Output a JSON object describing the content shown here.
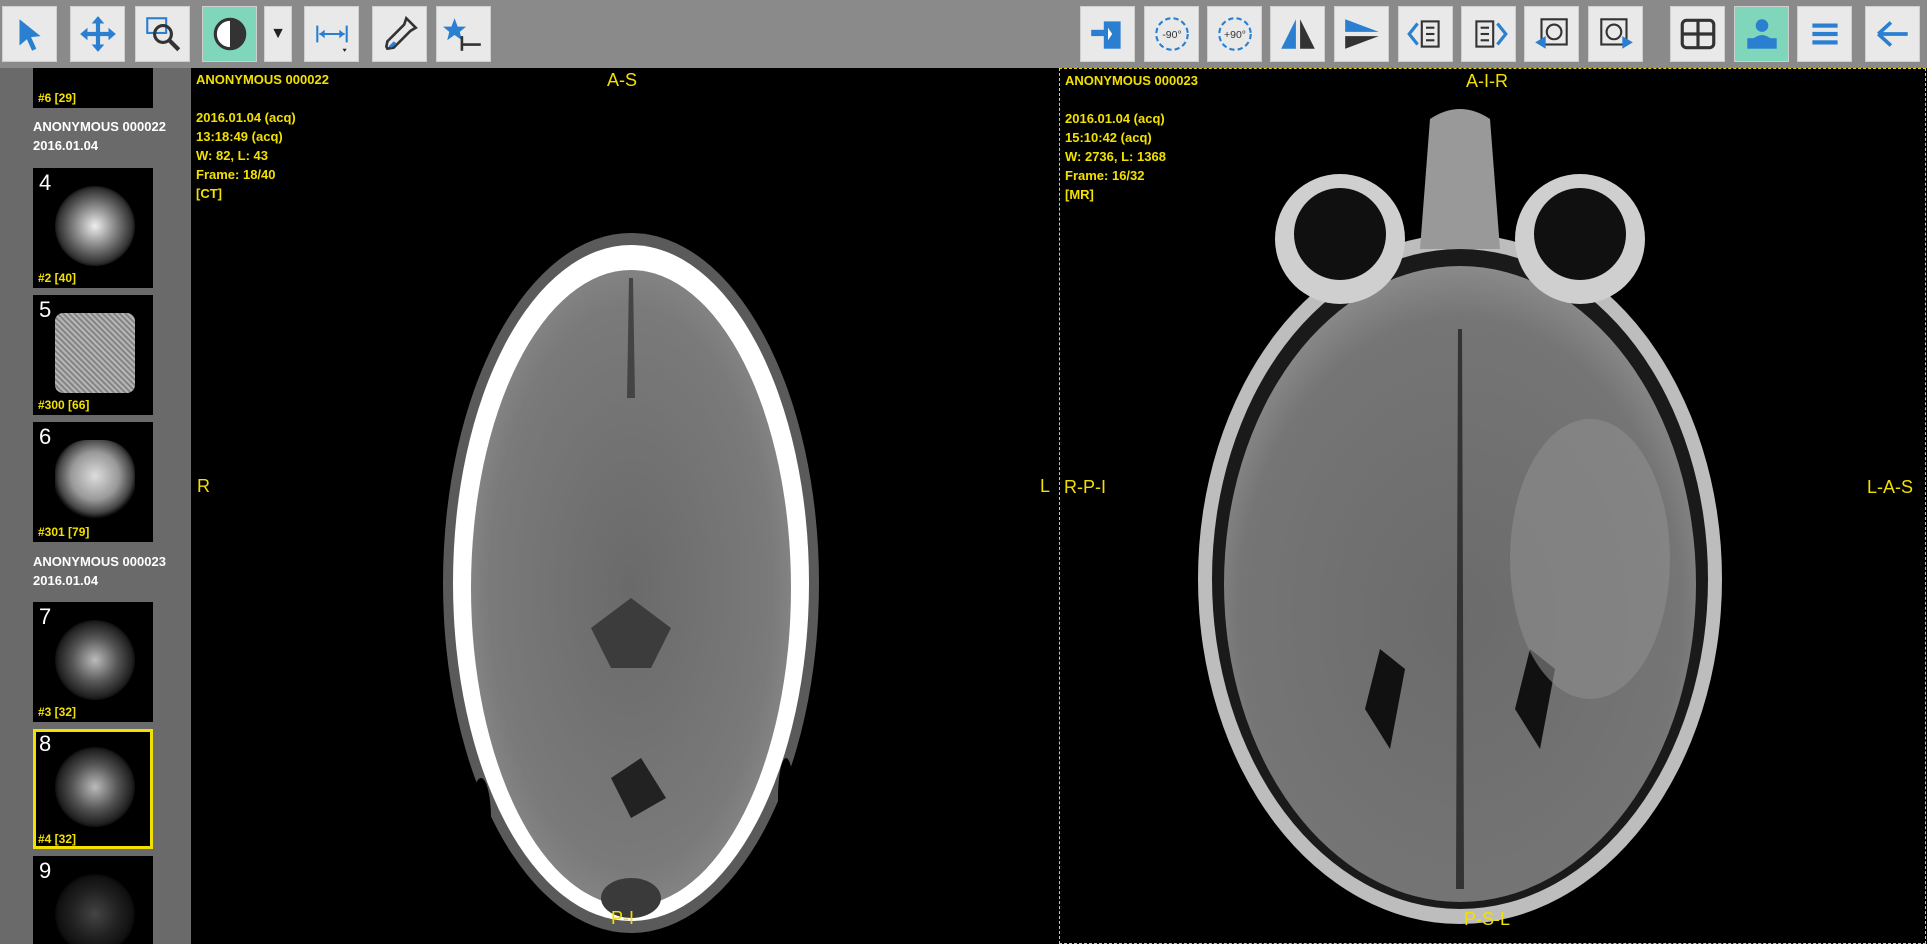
{
  "toolbar": {
    "left_tools": [
      {
        "id": "select",
        "icon": "pointer-arrow-icon",
        "active": false
      },
      {
        "id": "pan",
        "icon": "move-arrows-icon",
        "active": false
      },
      {
        "id": "zoom",
        "icon": "zoom-magnifier-icon",
        "active": false
      },
      {
        "id": "window-level",
        "icon": "contrast-half-circle-icon",
        "active": true
      },
      {
        "id": "measure",
        "icon": "ruler-distance-icon",
        "active": false
      },
      {
        "id": "probe",
        "icon": "eyedropper-icon",
        "active": false
      },
      {
        "id": "reference-lines",
        "icon": "crosshair-reference-icon",
        "active": false
      }
    ],
    "right_tools": [
      {
        "id": "info-toggle",
        "icon": "scroll-stack-icon",
        "active": false
      },
      {
        "id": "rotate-left",
        "icon": "rotate-left-icon",
        "label": "-90°",
        "active": false
      },
      {
        "id": "rotate-right",
        "icon": "rotate-right-icon",
        "label": "+90°",
        "active": false
      },
      {
        "id": "flip-horizontal",
        "icon": "flip-horizontal-icon",
        "active": false
      },
      {
        "id": "flip-vertical",
        "icon": "flip-vertical-icon",
        "active": false
      },
      {
        "id": "prev-series",
        "icon": "previous-series-icon",
        "active": false
      },
      {
        "id": "next-series",
        "icon": "next-series-icon",
        "active": false
      },
      {
        "id": "prev-study",
        "icon": "previous-study-icon",
        "active": false
      },
      {
        "id": "next-study",
        "icon": "next-study-icon",
        "active": false
      },
      {
        "id": "layout",
        "icon": "grid-layout-icon",
        "active": false
      },
      {
        "id": "presentation",
        "icon": "presentation-user-icon",
        "active": true
      },
      {
        "id": "menu",
        "icon": "hamburger-menu-icon",
        "active": false
      },
      {
        "id": "back",
        "icon": "back-arrow-icon",
        "active": false
      }
    ]
  },
  "sidebar": {
    "top_thumb_info": "#6 [29]",
    "studies": [
      {
        "name": "ANONYMOUS 000022",
        "date": "2016.01.04"
      },
      {
        "name": "ANONYMOUS 000023",
        "date": "2016.01.04"
      }
    ],
    "thumbs": [
      {
        "num": "4",
        "info": "#2 [40]",
        "selected": false
      },
      {
        "num": "5",
        "info": "#300 [66]",
        "selected": false
      },
      {
        "num": "6",
        "info": "#301 [79]",
        "selected": false
      },
      {
        "num": "7",
        "info": "#3 [32]",
        "selected": false
      },
      {
        "num": "8",
        "info": "#4 [32]",
        "selected": true
      },
      {
        "num": "9",
        "info": "",
        "selected": false
      }
    ]
  },
  "viewports": [
    {
      "patient": "ANONYMOUS 000022",
      "date": "2016.01.04 (acq)",
      "time": "13:18:49 (acq)",
      "wl": "W: 82, L: 43",
      "frame": "Frame: 18/40",
      "modality": "[CT]",
      "orient_top": "A-S",
      "orient_bottom": "P-I",
      "orient_left": "R",
      "orient_right": "L",
      "active": false
    },
    {
      "patient": "ANONYMOUS 000023",
      "date": "2016.01.04 (acq)",
      "time": "15:10:42 (acq)",
      "wl": "W: 2736, L: 1368",
      "frame": "Frame: 16/32",
      "modality": "[MR]",
      "orient_top": "A-I-R",
      "orient_bottom": "P-S-L",
      "orient_left": "R-P-I",
      "orient_right": "L-A-S",
      "active": true
    }
  ],
  "colors": {
    "accent": "#f2e000",
    "active_tool": "#7fd6ba",
    "sidebar": "#6a6a6a",
    "toolbar": "#8a8a8a"
  }
}
